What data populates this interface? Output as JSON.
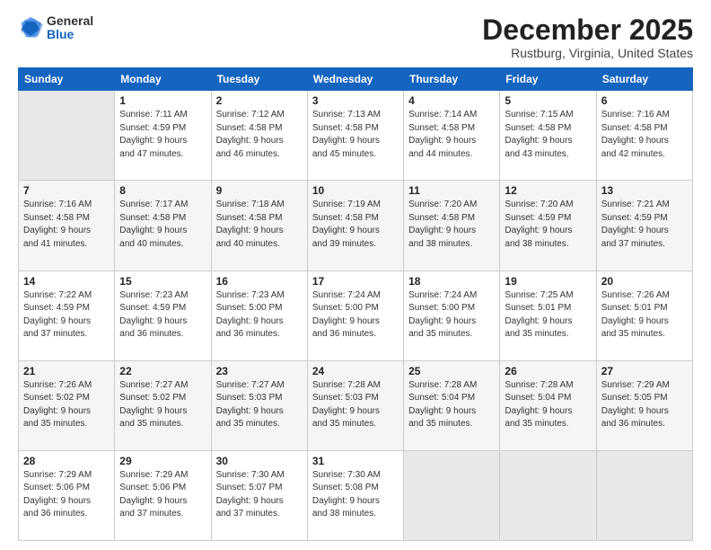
{
  "logo": {
    "general": "General",
    "blue": "Blue"
  },
  "header": {
    "month": "December 2025",
    "location": "Rustburg, Virginia, United States"
  },
  "weekdays": [
    "Sunday",
    "Monday",
    "Tuesday",
    "Wednesday",
    "Thursday",
    "Friday",
    "Saturday"
  ],
  "weeks": [
    [
      {
        "day": "",
        "empty": true
      },
      {
        "day": "1",
        "sunrise": "7:11 AM",
        "sunset": "4:59 PM",
        "daylight": "9 hours and 47 minutes."
      },
      {
        "day": "2",
        "sunrise": "7:12 AM",
        "sunset": "4:58 PM",
        "daylight": "9 hours and 46 minutes."
      },
      {
        "day": "3",
        "sunrise": "7:13 AM",
        "sunset": "4:58 PM",
        "daylight": "9 hours and 45 minutes."
      },
      {
        "day": "4",
        "sunrise": "7:14 AM",
        "sunset": "4:58 PM",
        "daylight": "9 hours and 44 minutes."
      },
      {
        "day": "5",
        "sunrise": "7:15 AM",
        "sunset": "4:58 PM",
        "daylight": "9 hours and 43 minutes."
      },
      {
        "day": "6",
        "sunrise": "7:16 AM",
        "sunset": "4:58 PM",
        "daylight": "9 hours and 42 minutes."
      }
    ],
    [
      {
        "day": "7",
        "sunrise": "7:16 AM",
        "sunset": "4:58 PM",
        "daylight": "9 hours and 41 minutes."
      },
      {
        "day": "8",
        "sunrise": "7:17 AM",
        "sunset": "4:58 PM",
        "daylight": "9 hours and 40 minutes."
      },
      {
        "day": "9",
        "sunrise": "7:18 AM",
        "sunset": "4:58 PM",
        "daylight": "9 hours and 40 minutes."
      },
      {
        "day": "10",
        "sunrise": "7:19 AM",
        "sunset": "4:58 PM",
        "daylight": "9 hours and 39 minutes."
      },
      {
        "day": "11",
        "sunrise": "7:20 AM",
        "sunset": "4:58 PM",
        "daylight": "9 hours and 38 minutes."
      },
      {
        "day": "12",
        "sunrise": "7:20 AM",
        "sunset": "4:59 PM",
        "daylight": "9 hours and 38 minutes."
      },
      {
        "day": "13",
        "sunrise": "7:21 AM",
        "sunset": "4:59 PM",
        "daylight": "9 hours and 37 minutes."
      }
    ],
    [
      {
        "day": "14",
        "sunrise": "7:22 AM",
        "sunset": "4:59 PM",
        "daylight": "9 hours and 37 minutes."
      },
      {
        "day": "15",
        "sunrise": "7:23 AM",
        "sunset": "4:59 PM",
        "daylight": "9 hours and 36 minutes."
      },
      {
        "day": "16",
        "sunrise": "7:23 AM",
        "sunset": "5:00 PM",
        "daylight": "9 hours and 36 minutes."
      },
      {
        "day": "17",
        "sunrise": "7:24 AM",
        "sunset": "5:00 PM",
        "daylight": "9 hours and 36 minutes."
      },
      {
        "day": "18",
        "sunrise": "7:24 AM",
        "sunset": "5:00 PM",
        "daylight": "9 hours and 35 minutes."
      },
      {
        "day": "19",
        "sunrise": "7:25 AM",
        "sunset": "5:01 PM",
        "daylight": "9 hours and 35 minutes."
      },
      {
        "day": "20",
        "sunrise": "7:26 AM",
        "sunset": "5:01 PM",
        "daylight": "9 hours and 35 minutes."
      }
    ],
    [
      {
        "day": "21",
        "sunrise": "7:26 AM",
        "sunset": "5:02 PM",
        "daylight": "9 hours and 35 minutes."
      },
      {
        "day": "22",
        "sunrise": "7:27 AM",
        "sunset": "5:02 PM",
        "daylight": "9 hours and 35 minutes."
      },
      {
        "day": "23",
        "sunrise": "7:27 AM",
        "sunset": "5:03 PM",
        "daylight": "9 hours and 35 minutes."
      },
      {
        "day": "24",
        "sunrise": "7:28 AM",
        "sunset": "5:03 PM",
        "daylight": "9 hours and 35 minutes."
      },
      {
        "day": "25",
        "sunrise": "7:28 AM",
        "sunset": "5:04 PM",
        "daylight": "9 hours and 35 minutes."
      },
      {
        "day": "26",
        "sunrise": "7:28 AM",
        "sunset": "5:04 PM",
        "daylight": "9 hours and 35 minutes."
      },
      {
        "day": "27",
        "sunrise": "7:29 AM",
        "sunset": "5:05 PM",
        "daylight": "9 hours and 36 minutes."
      }
    ],
    [
      {
        "day": "28",
        "sunrise": "7:29 AM",
        "sunset": "5:06 PM",
        "daylight": "9 hours and 36 minutes."
      },
      {
        "day": "29",
        "sunrise": "7:29 AM",
        "sunset": "5:06 PM",
        "daylight": "9 hours and 37 minutes."
      },
      {
        "day": "30",
        "sunrise": "7:30 AM",
        "sunset": "5:07 PM",
        "daylight": "9 hours and 37 minutes."
      },
      {
        "day": "31",
        "sunrise": "7:30 AM",
        "sunset": "5:08 PM",
        "daylight": "9 hours and 38 minutes."
      },
      {
        "day": "",
        "empty": true
      },
      {
        "day": "",
        "empty": true
      },
      {
        "day": "",
        "empty": true
      }
    ]
  ]
}
